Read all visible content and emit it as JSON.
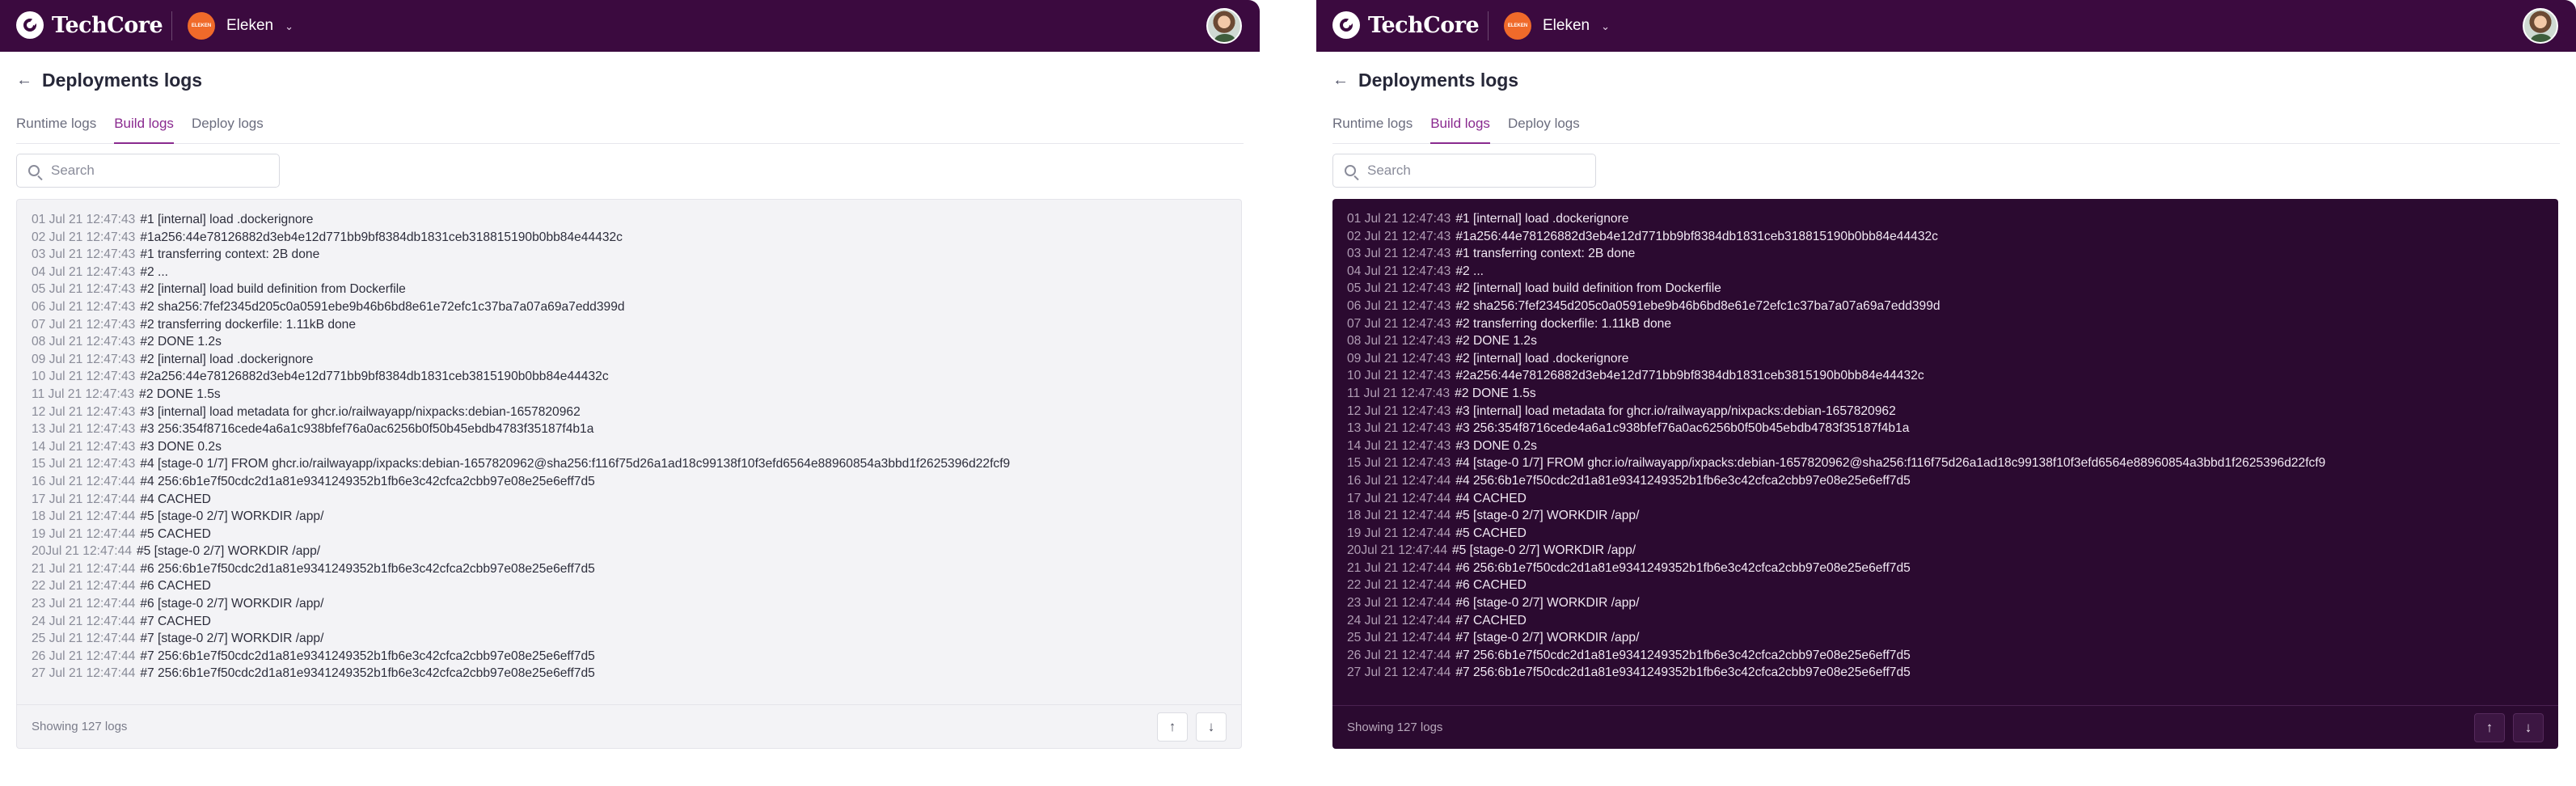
{
  "app": {
    "name": "TechCore",
    "org_avatar_text": "ELEKEN",
    "org_name": "Eleken",
    "org_chevron": "⌄",
    "colors": {
      "topbar": "#3b0a3f",
      "accent": "#8a2a8f",
      "org_avatar": "#f06a2a",
      "dark_log_bg": "#2b0a30"
    }
  },
  "page": {
    "back_icon": "←",
    "title": "Deployments logs",
    "tabs": [
      {
        "label": "Runtime logs",
        "active": false
      },
      {
        "label": "Build logs",
        "active": true
      },
      {
        "label": "Deploy logs",
        "active": false
      }
    ],
    "search_placeholder": "Search"
  },
  "logs": [
    {
      "meta": "01 Jul 21 12:47:43",
      "msg": "#1 [internal] load .dockerignore"
    },
    {
      "meta": "02 Jul 21 12:47:43",
      "msg": "#1a256:44e78126882d3eb4e12d771bb9bf8384db1831ceb318815190b0bb84e44432c"
    },
    {
      "meta": "03 Jul 21 12:47:43",
      "msg": "#1 transferring context: 2B done"
    },
    {
      "meta": "04 Jul 21 12:47:43",
      "msg": "#2 ..."
    },
    {
      "meta": "05 Jul 21 12:47:43",
      "msg": "#2 [internal] load build definition from Dockerfile"
    },
    {
      "meta": "06 Jul 21 12:47:43",
      "msg": "#2 sha256:7fef2345d205c0a0591ebe9b46b6bd8e61e72efc1c37ba7a07a69a7edd399d"
    },
    {
      "meta": "07 Jul 21 12:47:43",
      "msg": "#2 transferring dockerfile: 1.11kB done"
    },
    {
      "meta": "08 Jul 21 12:47:43",
      "msg": "#2 DONE 1.2s"
    },
    {
      "meta": "09 Jul 21 12:47:43",
      "msg": "#2 [internal] load .dockerignore"
    },
    {
      "meta": "10 Jul 21 12:47:43",
      "msg": "#2a256:44e78126882d3eb4e12d771bb9bf8384db1831ceb3815190b0bb84e44432c"
    },
    {
      "meta": "11 Jul 21 12:47:43",
      "msg": "#2 DONE 1.5s"
    },
    {
      "meta": "12 Jul 21 12:47:43",
      "msg": "#3 [internal] load metadata for ghcr.io/railwayapp/nixpacks:debian-1657820962"
    },
    {
      "meta": "13 Jul 21 12:47:43",
      "msg": "#3 256:354f8716cede4a6a1c938bfef76a0ac6256b0f50b45ebdb4783f35187f4b1a"
    },
    {
      "meta": "14 Jul 21 12:47:43",
      "msg": "#3 DONE 0.2s"
    },
    {
      "meta": "15 Jul 21 12:47:43",
      "msg": "#4 [stage-0 1/7] FROM ghcr.io/railwayapp/ixpacks:debian-1657820962@sha256:f116f75d26a1ad18c99138f10f3efd6564e88960854a3bbd1f2625396d22fcf9"
    },
    {
      "meta": "16 Jul 21 12:47:44",
      "msg": "#4 256:6b1e7f50cdc2d1a81e9341249352b1fb6e3c42cfca2cbb97e08e25e6eff7d5"
    },
    {
      "meta": "17 Jul 21 12:47:44",
      "msg": "#4 CACHED"
    },
    {
      "meta": "18 Jul 21 12:47:44",
      "msg": "#5 [stage-0 2/7] WORKDIR /app/"
    },
    {
      "meta": "19 Jul 21 12:47:44",
      "msg": "#5 CACHED"
    },
    {
      "meta": "20Jul 21 12:47:44",
      "msg": "#5 [stage-0 2/7] WORKDIR /app/"
    },
    {
      "meta": "21 Jul 21 12:47:44",
      "msg": "#6 256:6b1e7f50cdc2d1a81e9341249352b1fb6e3c42cfca2cbb97e08e25e6eff7d5"
    },
    {
      "meta": "22 Jul 21 12:47:44",
      "msg": "#6 CACHED"
    },
    {
      "meta": "23 Jul 21 12:47:44",
      "msg": "#6 [stage-0 2/7] WORKDIR /app/"
    },
    {
      "meta": "24 Jul 21 12:47:44",
      "msg": "#7 CACHED"
    },
    {
      "meta": "25 Jul 21 12:47:44",
      "msg": "#7 [stage-0 2/7] WORKDIR /app/"
    },
    {
      "meta": "26 Jul 21 12:47:44",
      "msg": "#7 256:6b1e7f50cdc2d1a81e9341249352b1fb6e3c42cfca2cbb97e08e25e6eff7d5"
    },
    {
      "meta": "27 Jul 21 12:47:44",
      "msg": "#7 256:6b1e7f50cdc2d1a81e9341249352b1fb6e3c42cfca2cbb97e08e25e6eff7d5"
    }
  ],
  "footer": {
    "count_text": "Showing 127 logs",
    "up_icon": "↑",
    "down_icon": "↓"
  },
  "themes": [
    "light",
    "dark"
  ]
}
